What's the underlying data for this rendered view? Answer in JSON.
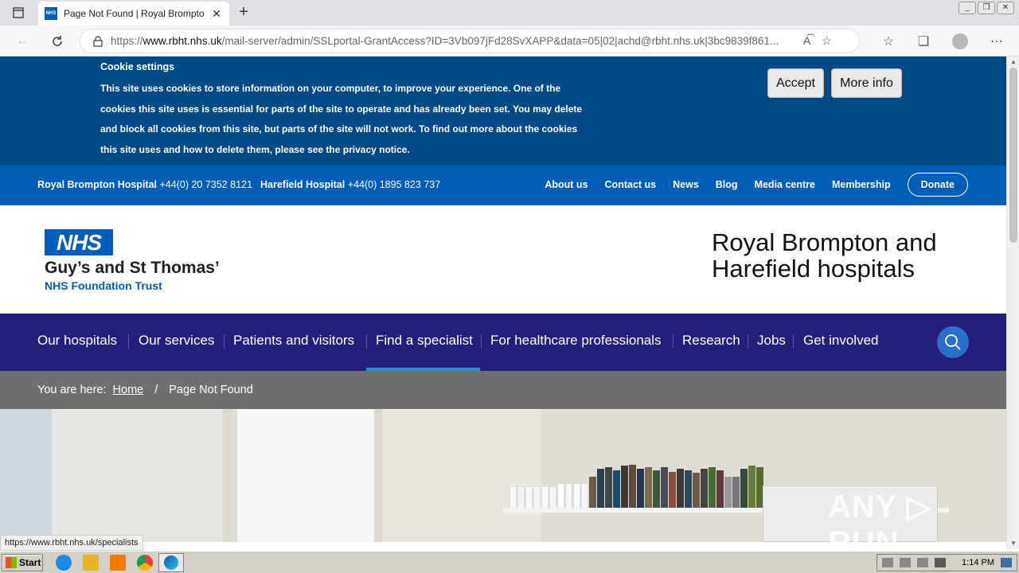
{
  "browser": {
    "tab_title": "Page Not Found | Royal Brompton",
    "favicon_text": "NHS",
    "new_tab": "+",
    "tab_close": "✕",
    "url_prefix": "https://",
    "url_domain": "www.rbht.nhs.uk",
    "url_rest": "/mail-server/admin/SSLportal-GrantAccess?ID=3Vb097jFd28SvXAPP&data=05|02|achd@rbht.nhs.uk|3bc9839f861..."
  },
  "cookie": {
    "title": "Cookie settings",
    "text": "This site uses cookies to store information on your computer, to improve your experience. One of the cookies this site uses is essential for parts of the site to operate and has already been set. You may delete and block all cookies from this site, but parts of the site will not work. To find out more about the cookies this site uses and how to delete them, please see the privacy notice.",
    "accept_label": "Accept",
    "more_info_label": "More info"
  },
  "topbar": {
    "hospital1_name": "Royal Brompton Hospital",
    "hospital1_phone": "+44(0) 20 7352 8121",
    "hospital2_name": "Harefield Hospital",
    "hospital2_phone": "+44(0) 1895 823 737",
    "links": [
      "About us",
      "Contact us",
      "News",
      "Blog",
      "Media centre",
      "Membership"
    ],
    "donate_label": "Donate"
  },
  "header": {
    "nhs_logo": "NHS",
    "trust_name": "Guy’s and St Thomas’",
    "trust_sub": "NHS Foundation Trust",
    "site_name_line1": "Royal Brompton and",
    "site_name_line2": "Harefield hospitals"
  },
  "mainnav": {
    "items": [
      "Our hospitals",
      "Our services",
      "Patients and visitors",
      "Find a specialist",
      "For healthcare professionals",
      "Research",
      "Jobs",
      "Get involved"
    ],
    "active": "Find a specialist"
  },
  "breadcrumb": {
    "prefix": "You are here:",
    "home": "Home",
    "separator": "/",
    "current": "Page Not Found"
  },
  "watermark": "ANY ▷ RUN",
  "status_url": "https://www.rbht.nhs.uk/specialists",
  "taskbar": {
    "start_label": "Start",
    "clock": "1:14 PM"
  }
}
